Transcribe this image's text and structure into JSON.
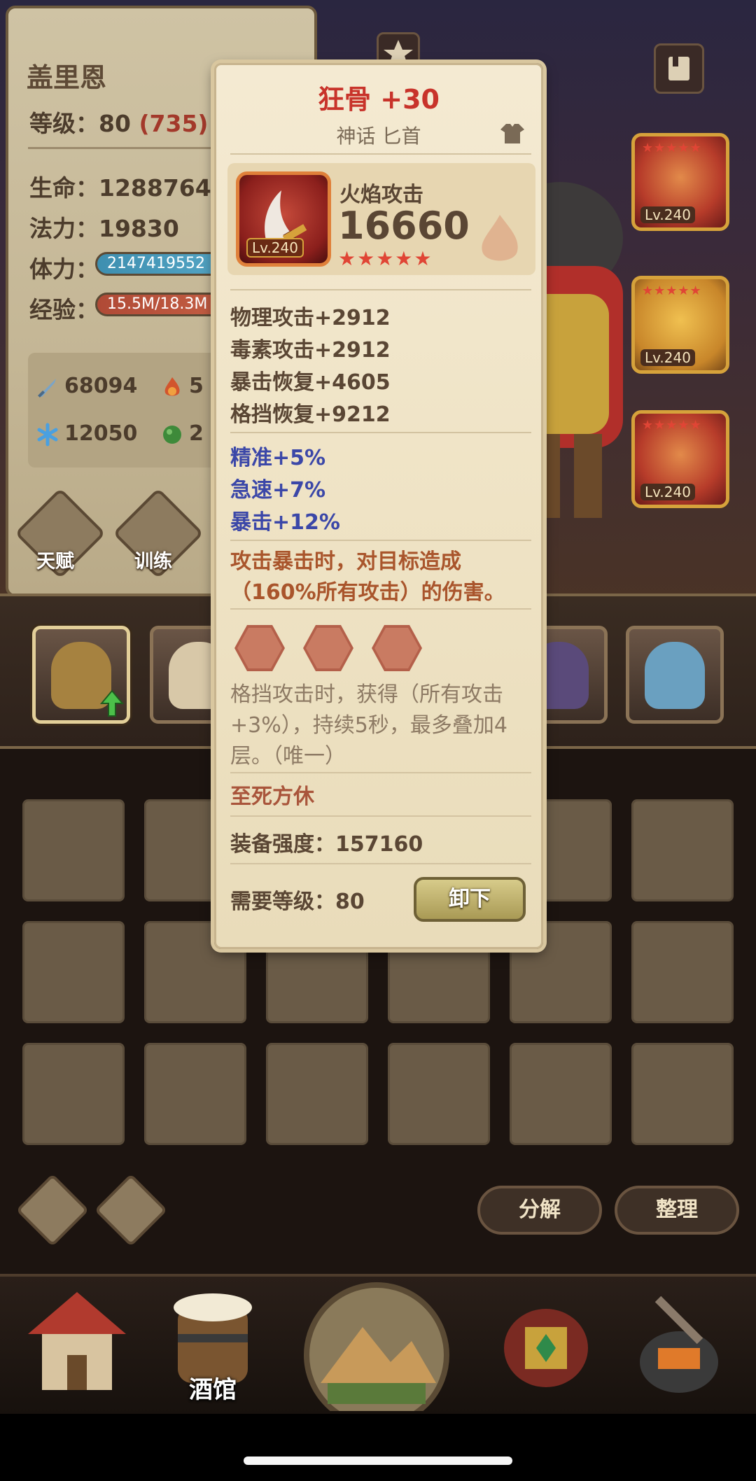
{
  "hero": {
    "name": "盖里恩",
    "level_label": "等级：",
    "level": "80",
    "level_extra": "(735)",
    "hp_label": "生命：",
    "hp": "1288764",
    "mana_label": "法力：",
    "mana": "19830",
    "stamina_label": "体力：",
    "stamina": "2147419552",
    "exp_label": "经验：",
    "exp": "15.5M/18.3M"
  },
  "powers": [
    {
      "icon": "sword-icon",
      "value": "68094"
    },
    {
      "icon": "fire-icon",
      "value": "5"
    },
    {
      "icon": "ice-icon",
      "value": "12050"
    },
    {
      "icon": "poison-icon",
      "value": "2"
    }
  ],
  "buttons": {
    "talent": "天赋",
    "train": "训练",
    "decompose": "分解",
    "sort": "整理"
  },
  "equip_slots": [
    {
      "level": "Lv.240"
    },
    {
      "level": "Lv.240"
    },
    {
      "level": "Lv.240"
    }
  ],
  "tooltip": {
    "title": "狂骨 +30",
    "subtitle": "神话 匕首",
    "item_name": "火焰攻击",
    "item_level": "Lv.240",
    "score": "16660",
    "stars": "★★★★★",
    "base_stats": [
      "物理攻击+2912",
      "毒素攻击+2912",
      "暴击恢复+4605",
      "格挡恢复+9212"
    ],
    "bonus_stats": [
      "精准+5%",
      "急速+7%",
      "暴击+12%"
    ],
    "special_1": "攻击暴击时，对目标造成（160%所有攻击）的伤害。",
    "gem_description": "格挡攻击时，获得（所有攻击+3%），持续5秒，最多叠加4层。（唯一）",
    "set_name": "至死方休",
    "strength_label": "装备强度：",
    "strength": "157160",
    "req_level_label": "需要等级：",
    "req_level": "80",
    "unequip": "卸下"
  },
  "nav": {
    "tavern": "酒馆"
  },
  "colors": {
    "title_red": "#c8332a",
    "bonus_blue": "#3b47a8",
    "special_orange": "#a9552c",
    "parchment": "#f0e4c6"
  }
}
